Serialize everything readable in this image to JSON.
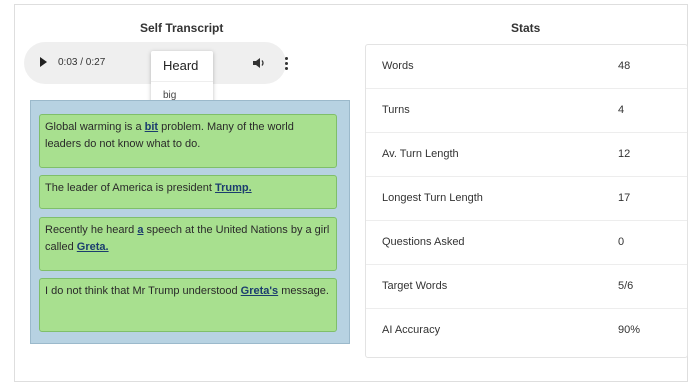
{
  "left_panel": {
    "title": "Self Transcript",
    "player": {
      "time": "0:03 / 0:27"
    },
    "popup": {
      "heard_label": "Heard",
      "option": "big"
    },
    "messages": [
      {
        "parts": [
          {
            "t": "Global warming is a "
          },
          {
            "t": "bit",
            "hl": true
          },
          {
            "t": " problem. Many of the world leaders do not know what to do."
          }
        ]
      },
      {
        "parts": [
          {
            "t": "The leader of America is president "
          },
          {
            "t": "Trump.",
            "hl": true
          }
        ]
      },
      {
        "parts": [
          {
            "t": "Recently he heard "
          },
          {
            "t": "a",
            "hl": true
          },
          {
            "t": " speech at the United Nations by a girl called "
          },
          {
            "t": "Greta.",
            "hl": true
          }
        ]
      },
      {
        "parts": [
          {
            "t": "I do not think that Mr Trump understood "
          },
          {
            "t": "Greta's",
            "hl": true
          },
          {
            "t": " message."
          }
        ]
      }
    ]
  },
  "right_panel": {
    "title": "Stats",
    "rows": [
      {
        "label": "Words",
        "value": "48"
      },
      {
        "label": "Turns",
        "value": "4"
      },
      {
        "label": "Av. Turn Length",
        "value": "12"
      },
      {
        "label": "Longest Turn Length",
        "value": "17"
      },
      {
        "label": "Questions Asked",
        "value": "0"
      },
      {
        "label": "Target Words",
        "value": "5/6"
      },
      {
        "label": "AI Accuracy",
        "value": "90%"
      }
    ]
  }
}
